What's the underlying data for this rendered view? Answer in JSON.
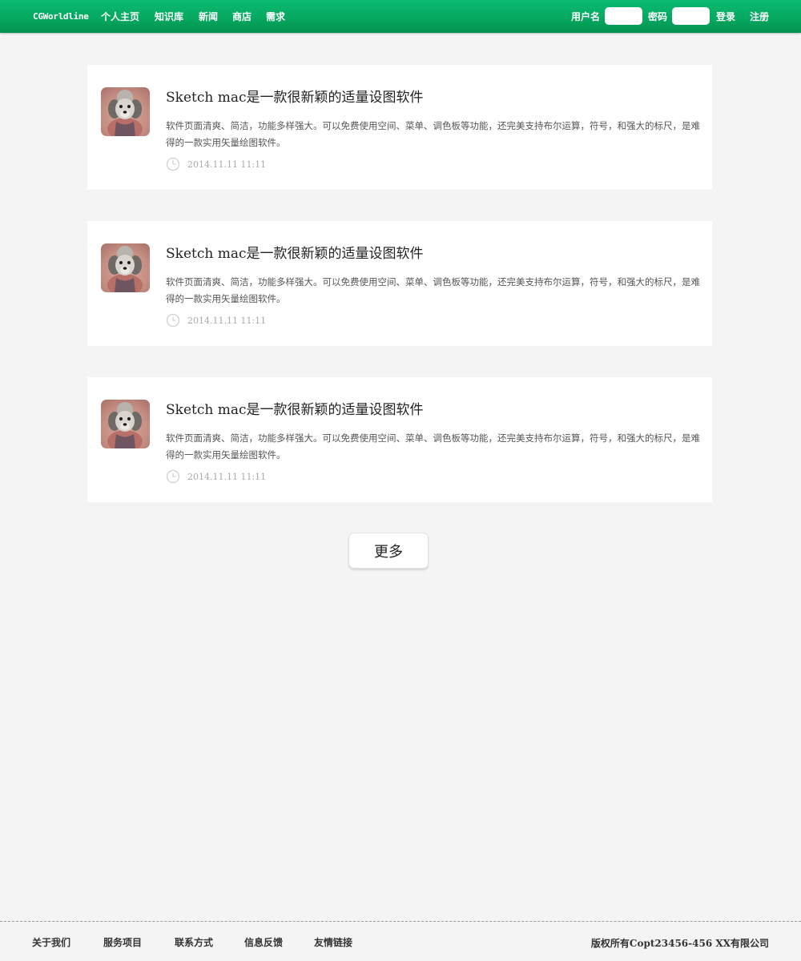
{
  "nav": {
    "brand": "CGWorldline",
    "links": [
      "个人主页",
      "知识库",
      "新闻",
      "商店",
      "需求"
    ],
    "username_label": "用户名",
    "password_label": "密码",
    "username_value": "",
    "password_value": "",
    "login": "登录",
    "register": "注册"
  },
  "colors": {
    "nav_green": "#06a860",
    "page_bg": "#f4f4f4"
  },
  "icons": {
    "avatar": "poodle-avatar-icon",
    "time": "clock-icon"
  },
  "posts": [
    {
      "title": "Sketch mac是一款很新颖的适量设图软件",
      "description": "软件页面清爽、简洁，功能多样强大。可以免费使用空间、菜单、调色板等功能，还完美支持布尔运算，符号，和强大的标尺，是难得的一款实用矢量绘图软件。",
      "time": "2014.11.11 11:11"
    },
    {
      "title": "Sketch mac是一款很新颖的适量设图软件",
      "description": "软件页面清爽、简洁，功能多样强大。可以免费使用空间、菜单、调色板等功能，还完美支持布尔运算，符号，和强大的标尺，是难得的一款实用矢量绘图软件。",
      "time": "2014.11.11 11:11"
    },
    {
      "title": "Sketch mac是一款很新颖的适量设图软件",
      "description": "软件页面清爽、简洁，功能多样强大。可以免费使用空间、菜单、调色板等功能，还完美支持布尔运算，符号，和强大的标尺，是难得的一款实用矢量绘图软件。",
      "time": "2014.11.11 11:11"
    }
  ],
  "more_button": "更多",
  "footer": {
    "links": [
      "关于我们",
      "服务项目",
      "联系方式",
      "信息反馈",
      "友情链接"
    ],
    "copyright": "版权所有Copt23456-456 XX有限公司"
  }
}
